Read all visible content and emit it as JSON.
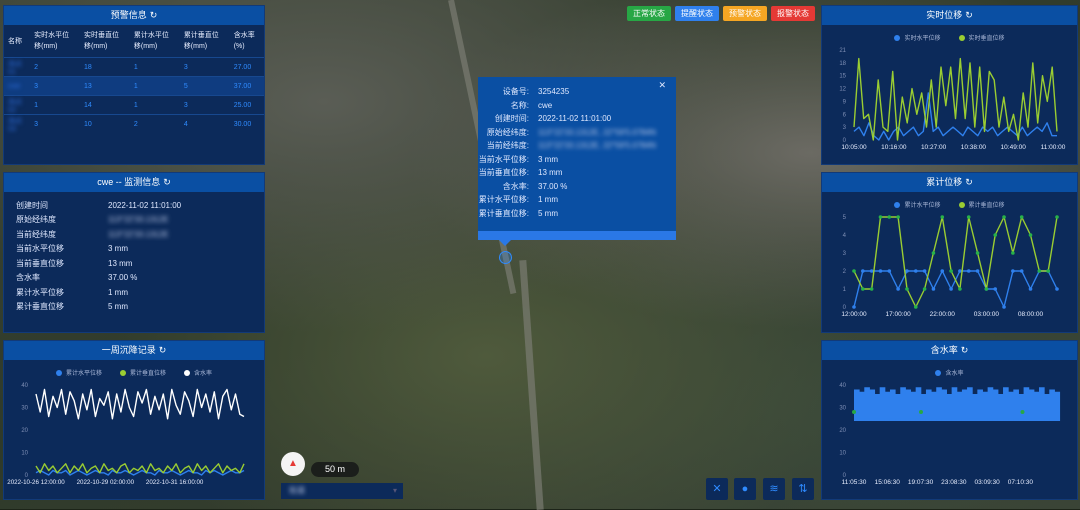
{
  "status_buttons": [
    {
      "label": "正常状态",
      "color": "#27a745"
    },
    {
      "label": "提醒状态",
      "color": "#2f80ed"
    },
    {
      "label": "预警状态",
      "color": "#f5a623"
    },
    {
      "label": "报警状态",
      "color": "#e53935"
    }
  ],
  "map": {
    "scale": "50 m",
    "layer_select": "街道"
  },
  "warning": {
    "title": "预警信息",
    "columns": [
      "名称",
      "实时水平位移(mm)",
      "实时垂直位移(mm)",
      "累计水平位移(mm)",
      "累计垂直位移(mm)",
      "含水率(%)"
    ],
    "rows": [
      [
        "测点01",
        "2",
        "18",
        "1",
        "3",
        "27.00"
      ],
      [
        "cwe",
        "3",
        "13",
        "1",
        "5",
        "37.00"
      ],
      [
        "测点02",
        "1",
        "14",
        "1",
        "3",
        "25.00"
      ],
      [
        "测点03",
        "3",
        "10",
        "2",
        "4",
        "30.00"
      ]
    ]
  },
  "monitor": {
    "title": "cwe -- 监测信息",
    "rows": [
      [
        "创建时间",
        "2022-11-02 11:01:00"
      ],
      [
        "原始经纬度",
        "113°22'33.1312E",
        "blur"
      ],
      [
        "当前经纬度",
        "113°22'33.1312E",
        "blur"
      ],
      [
        "当前水平位移",
        "3 mm"
      ],
      [
        "当前垂直位移",
        "13 mm"
      ],
      [
        "含水率",
        "37.00 %"
      ],
      [
        "累计水平位移",
        "1 mm"
      ],
      [
        "累计垂直位移",
        "5 mm"
      ]
    ]
  },
  "popup": {
    "rows": [
      [
        "设备号:",
        "3254235"
      ],
      [
        "名称:",
        "cwe"
      ],
      [
        "创建时间:",
        "2022-11-02 11:01:00"
      ],
      [
        "原始经纬度:",
        "113°22'33.1312E, 22°59'5.0784N",
        "blur"
      ],
      [
        "当前经纬度:",
        "113°22'33.1312E, 22°59'5.0784N",
        "blur"
      ],
      [
        "当前水平位移:",
        "3 mm"
      ],
      [
        "当前垂直位移:",
        "13 mm"
      ],
      [
        "含水率:",
        "37.00 %"
      ],
      [
        "累计水平位移:",
        "1 mm"
      ],
      [
        "累计垂直位移:",
        "5 mm"
      ]
    ]
  },
  "chart_data": [
    {
      "id": "week",
      "type": "line",
      "title": "一周沉降记录",
      "yticks": [
        0,
        10,
        20,
        30,
        40
      ],
      "ylim": [
        0,
        40
      ],
      "xticks": [
        "2022-10-26 12:00:00",
        "2022-10-29 02:00:00",
        "2022-10-31 16:00:00"
      ],
      "series": [
        {
          "name": "累计水平位移",
          "color": "#2f80ed",
          "values": [
            1,
            2,
            1,
            0,
            2,
            1,
            1,
            2,
            0,
            1,
            2,
            1,
            0,
            1,
            2,
            1,
            1,
            0,
            2,
            1,
            1,
            2,
            1,
            0,
            1,
            2,
            1,
            1,
            0,
            2,
            1,
            1,
            2,
            1,
            0,
            1,
            2,
            1,
            1,
            0,
            2,
            1,
            2,
            1,
            0,
            1,
            2,
            1,
            1,
            2
          ]
        },
        {
          "name": "累计垂直位移",
          "color": "#9acd32",
          "values": [
            4,
            1,
            5,
            2,
            4,
            1,
            3,
            5,
            1,
            4,
            2,
            5,
            1,
            3,
            4,
            1,
            5,
            2,
            3,
            1,
            4,
            5,
            1,
            3,
            2,
            4,
            1,
            5,
            2,
            3,
            1,
            4,
            2,
            5,
            1,
            3,
            4,
            1,
            5,
            2,
            4,
            1,
            3,
            5,
            1,
            4,
            2,
            3,
            1,
            5
          ]
        },
        {
          "name": "含水率",
          "color": "#ffffff",
          "values": [
            36,
            28,
            38,
            26,
            35,
            30,
            38,
            27,
            37,
            33,
            25,
            36,
            29,
            38,
            26,
            34,
            31,
            37,
            25,
            36,
            28,
            38,
            30,
            26,
            37,
            32,
            38,
            27,
            35,
            29,
            36,
            25,
            38,
            31,
            27,
            37,
            33,
            26,
            38,
            30,
            36,
            28,
            37,
            25,
            35,
            38,
            29,
            36,
            27,
            26
          ]
        }
      ]
    },
    {
      "id": "realtime",
      "type": "line",
      "title": "实时位移",
      "yticks": [
        0,
        3,
        6,
        9,
        12,
        15,
        18,
        21
      ],
      "ylim": [
        0,
        21
      ],
      "xticks": [
        "10:05:00",
        "10:16:00",
        "10:27:00",
        "10:38:00",
        "10:49:00",
        "11:00:00"
      ],
      "series": [
        {
          "name": "实时水平位移",
          "color": "#2f80ed",
          "values": [
            2,
            3,
            1,
            4,
            1,
            0,
            2,
            0,
            2,
            3,
            1,
            2,
            3,
            1,
            2,
            11,
            2,
            3,
            1,
            2,
            3,
            2,
            1,
            3,
            2,
            1,
            3,
            2,
            3,
            1,
            2,
            3,
            2,
            1,
            3,
            1,
            2,
            3,
            2,
            4,
            1,
            1
          ]
        },
        {
          "name": "实时垂直位移",
          "color": "#9acd32",
          "values": [
            3,
            19,
            5,
            6,
            0,
            14,
            3,
            2,
            16,
            0,
            10,
            4,
            12,
            6,
            11,
            3,
            14,
            3,
            17,
            8,
            17,
            5,
            19,
            5,
            18,
            3,
            17,
            2,
            16,
            14,
            3,
            10,
            2,
            6,
            0,
            11,
            3,
            18,
            4,
            15,
            9,
            17,
            2
          ]
        }
      ]
    },
    {
      "id": "cumulative",
      "type": "line",
      "title": "累计位移",
      "yticks": [
        0,
        1,
        2,
        3,
        4,
        5
      ],
      "ylim": [
        0,
        5
      ],
      "xticks": [
        "12:00:00",
        "17:00:00",
        "22:00:00",
        "03:00:00",
        "08:00:00"
      ],
      "series": [
        {
          "name": "累计水平位移",
          "color": "#2f80ed",
          "values": [
            0,
            2,
            2,
            2,
            2,
            1,
            2,
            2,
            2,
            1,
            2,
            1,
            2,
            2,
            2,
            1,
            1,
            0,
            2,
            2,
            1,
            2,
            2,
            1
          ]
        },
        {
          "name": "累计垂直位移",
          "color": "#9acd32",
          "values": [
            2,
            1,
            1,
            5,
            5,
            5,
            1,
            0,
            1,
            3,
            5,
            2,
            1,
            5,
            3,
            1,
            4,
            5,
            3,
            5,
            4,
            2,
            2,
            5
          ]
        }
      ]
    },
    {
      "id": "moisture",
      "type": "area",
      "title": "含水率",
      "yticks": [
        0,
        10,
        20,
        30,
        40
      ],
      "ylim": [
        0,
        40
      ],
      "xticks": [
        "11:05:30",
        "15:06:30",
        "19:07:30",
        "23:08:30",
        "03:09:30",
        "07:10:30"
      ],
      "series": [
        {
          "name": "含水率",
          "color": "#2f80ed",
          "values": [
            38,
            25,
            37,
            26,
            39,
            24,
            38,
            27,
            36,
            25,
            39,
            26,
            37,
            24,
            38,
            28,
            36,
            25,
            39,
            26,
            38,
            24,
            37,
            27,
            39,
            25,
            36,
            26,
            38,
            24,
            37,
            28,
            39,
            25,
            38,
            26,
            36,
            24,
            39,
            27,
            37,
            25,
            38,
            26,
            39,
            24,
            36,
            28,
            38,
            25,
            37,
            26,
            39,
            24,
            38,
            27,
            36,
            25,
            39,
            26,
            37,
            24,
            38,
            28,
            36,
            25,
            39,
            26,
            38,
            24,
            37,
            27,
            39,
            25,
            36,
            26,
            38,
            24,
            37,
            28
          ]
        }
      ]
    }
  ]
}
